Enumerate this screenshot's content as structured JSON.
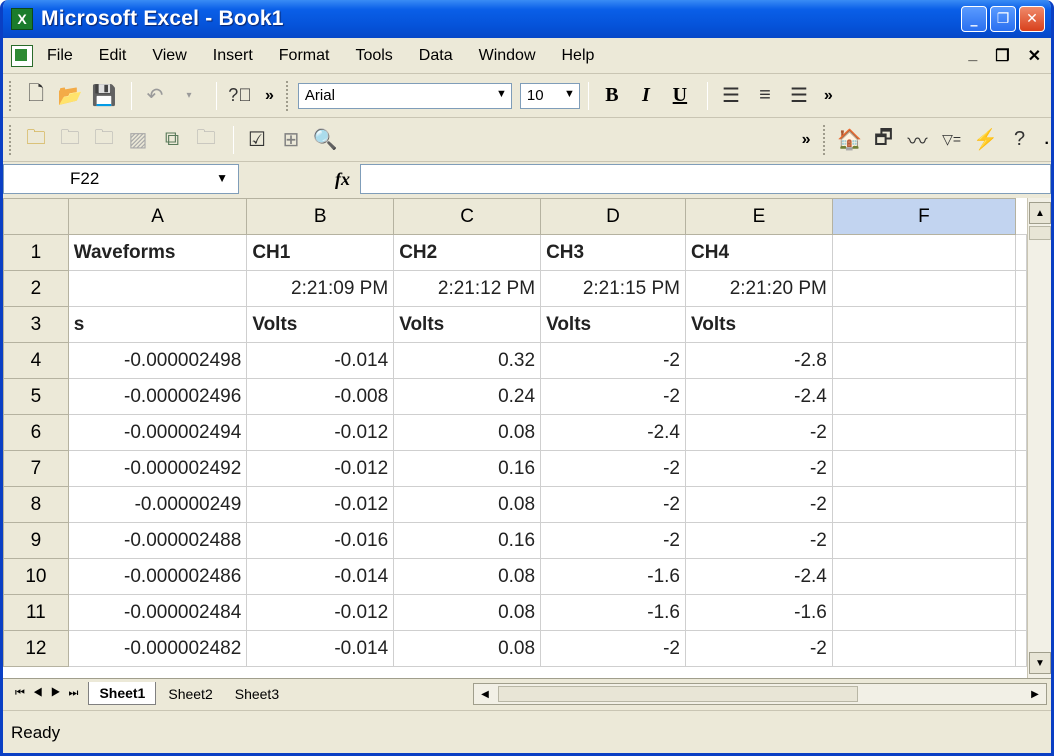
{
  "window": {
    "title": "Microsoft Excel - Book1",
    "app_icon": "excel-icon"
  },
  "menu": {
    "items": [
      "File",
      "Edit",
      "View",
      "Insert",
      "Format",
      "Tools",
      "Data",
      "Window",
      "Help"
    ]
  },
  "format_toolbar": {
    "font_name": "Arial",
    "font_size": "10",
    "bold_label": "B",
    "italic_label": "I",
    "underline_label": "U"
  },
  "formula_bar": {
    "name_box": "F22",
    "fx_label": "fx",
    "formula": ""
  },
  "sheet": {
    "columns": [
      "A",
      "B",
      "C",
      "D",
      "E",
      "F"
    ],
    "selected_column": "F",
    "rows": [
      {
        "num": "1",
        "cells": [
          "Waveforms",
          "CH1",
          "CH2",
          "CH3",
          "CH4",
          ""
        ]
      },
      {
        "num": "2",
        "cells": [
          "",
          "2:21:09 PM",
          "2:21:12 PM",
          "2:21:15 PM",
          "2:21:20 PM",
          ""
        ]
      },
      {
        "num": "3",
        "cells": [
          "s",
          "Volts",
          "Volts",
          "Volts",
          "Volts",
          ""
        ]
      },
      {
        "num": "4",
        "cells": [
          "-0.000002498",
          "-0.014",
          "0.32",
          "-2",
          "-2.8",
          ""
        ]
      },
      {
        "num": "5",
        "cells": [
          "-0.000002496",
          "-0.008",
          "0.24",
          "-2",
          "-2.4",
          ""
        ]
      },
      {
        "num": "6",
        "cells": [
          "-0.000002494",
          "-0.012",
          "0.08",
          "-2.4",
          "-2",
          ""
        ]
      },
      {
        "num": "7",
        "cells": [
          "-0.000002492",
          "-0.012",
          "0.16",
          "-2",
          "-2",
          ""
        ]
      },
      {
        "num": "8",
        "cells": [
          "-0.00000249",
          "-0.012",
          "0.08",
          "-2",
          "-2",
          ""
        ]
      },
      {
        "num": "9",
        "cells": [
          "-0.000002488",
          "-0.016",
          "0.16",
          "-2",
          "-2",
          ""
        ]
      },
      {
        "num": "10",
        "cells": [
          "-0.000002486",
          "-0.014",
          "0.08",
          "-1.6",
          "-2.4",
          ""
        ]
      },
      {
        "num": "11",
        "cells": [
          "-0.000002484",
          "-0.012",
          "0.08",
          "-1.6",
          "-1.6",
          ""
        ]
      },
      {
        "num": "12",
        "cells": [
          "-0.000002482",
          "-0.014",
          "0.08",
          "-2",
          "-2",
          ""
        ]
      }
    ]
  },
  "tabs": [
    "Sheet1",
    "Sheet2",
    "Sheet3"
  ],
  "active_tab": "Sheet1",
  "status": "Ready"
}
